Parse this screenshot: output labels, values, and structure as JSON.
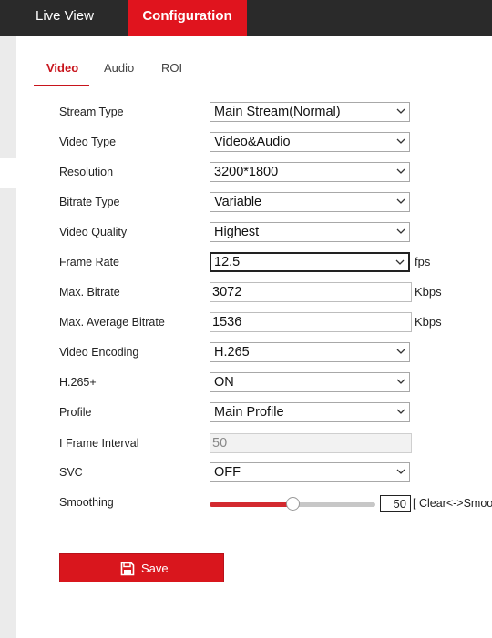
{
  "nav": {
    "live_view": "Live View",
    "configuration": "Configuration"
  },
  "tabs": [
    {
      "label": "Video",
      "active": true
    },
    {
      "label": "Audio",
      "active": false
    },
    {
      "label": "ROI",
      "active": false
    }
  ],
  "form": {
    "stream_type": {
      "label": "Stream Type",
      "value": "Main Stream(Normal)"
    },
    "video_type": {
      "label": "Video Type",
      "value": "Video&Audio"
    },
    "resolution": {
      "label": "Resolution",
      "value": "3200*1800"
    },
    "bitrate_type": {
      "label": "Bitrate Type",
      "value": "Variable"
    },
    "video_quality": {
      "label": "Video Quality",
      "value": "Highest"
    },
    "frame_rate": {
      "label": "Frame Rate",
      "value": "12.5",
      "unit": "fps"
    },
    "max_bitrate": {
      "label": "Max. Bitrate",
      "value": "3072",
      "unit": "Kbps"
    },
    "max_avg_bitrate": {
      "label": "Max. Average Bitrate",
      "value": "1536",
      "unit": "Kbps"
    },
    "video_encoding": {
      "label": "Video Encoding",
      "value": "H.265"
    },
    "h265_plus": {
      "label": "H.265+",
      "value": "ON"
    },
    "profile": {
      "label": "Profile",
      "value": "Main Profile"
    },
    "i_frame_interval": {
      "label": "I Frame Interval",
      "value": "50"
    },
    "svc": {
      "label": "SVC",
      "value": "OFF"
    },
    "smoothing": {
      "label": "Smoothing",
      "value": "50",
      "level": 0.5,
      "legend": "[ Clear<->Smoo"
    }
  },
  "save_button": {
    "label": "Save",
    "icon": "floppy-disk-icon"
  },
  "colors": {
    "accent": "#e0141e",
    "topbar": "#2a2a2a",
    "slider_fill": "#d32a2f"
  }
}
